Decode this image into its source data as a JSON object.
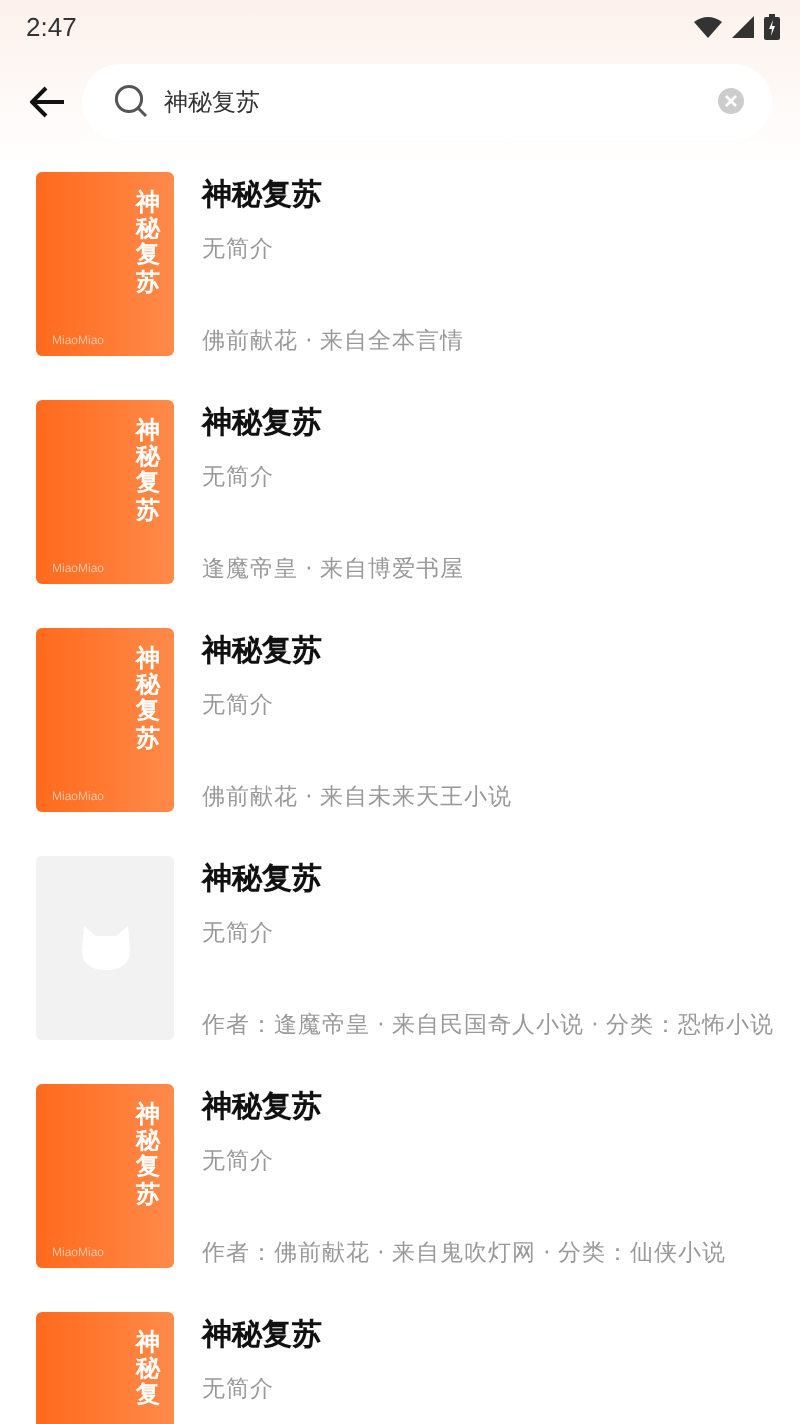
{
  "status_bar": {
    "time": "2:47"
  },
  "search": {
    "value": "神秘复苏"
  },
  "results": [
    {
      "title": "神秘复苏",
      "summary": "无简介",
      "meta": "佛前献花 · 来自全本言情",
      "cover": {
        "kind": "orange",
        "title": "神秘复苏",
        "brand": "MiaoMiao"
      }
    },
    {
      "title": "神秘复苏",
      "summary": "无简介",
      "meta": "逢魔帝皇 · 来自博爱书屋",
      "cover": {
        "kind": "orange",
        "title": "神秘复苏",
        "brand": "MiaoMiao"
      }
    },
    {
      "title": "神秘复苏",
      "summary": "无简介",
      "meta": "佛前献花 · 来自未来天王小说",
      "cover": {
        "kind": "orange",
        "title": "神秘复苏",
        "brand": "MiaoMiao"
      }
    },
    {
      "title": "神秘复苏",
      "summary": "无简介",
      "meta": "作者：逢魔帝皇 · 来自民国奇人小说 · 分类：恐怖小说",
      "cover": {
        "kind": "placeholder"
      }
    },
    {
      "title": "神秘复苏",
      "summary": "无简介",
      "meta": "作者：佛前献花 · 来自鬼吹灯网 · 分类：仙侠小说",
      "cover": {
        "kind": "orange",
        "title": "神秘复苏",
        "brand": "MiaoMiao"
      }
    },
    {
      "title": "神秘复苏",
      "summary": "无简介",
      "cover": {
        "kind": "orange",
        "title": "神秘复"
      }
    }
  ]
}
